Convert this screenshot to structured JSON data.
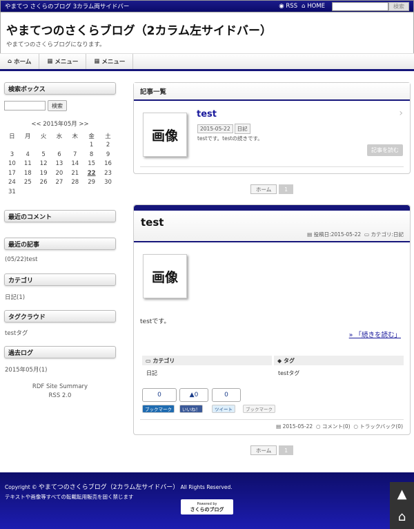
{
  "topbar": {
    "tagline": "やまてつ さくらのブログ 3カラム両サイドバー",
    "rss": "RSS",
    "home": "HOME",
    "search_button": "検索"
  },
  "header": {
    "title": "やまてつのさくらブログ（2カラム左サイドバー）",
    "subtitle": "やまてつのさくらブログになります。"
  },
  "nav": [
    {
      "label": "ホーム",
      "icon": "home-icon"
    },
    {
      "label": "メニュー",
      "icon": "grid-icon"
    },
    {
      "label": "メニュー",
      "icon": "grid-icon"
    }
  ],
  "sidebar": {
    "search": {
      "heading": "検索ボックス",
      "button": "検索"
    },
    "calendar": {
      "caption": "<< 2015年05月 >>",
      "weekdays": [
        "日",
        "月",
        "火",
        "水",
        "木",
        "金",
        "土"
      ],
      "rows": [
        [
          "",
          "",
          "",
          "",
          "",
          "1",
          "2"
        ],
        [
          "3",
          "4",
          "5",
          "6",
          "7",
          "8",
          "9"
        ],
        [
          "10",
          "11",
          "12",
          "13",
          "14",
          "15",
          "16"
        ],
        [
          "17",
          "18",
          "19",
          "20",
          "21",
          "22",
          "23"
        ],
        [
          "24",
          "25",
          "26",
          "27",
          "28",
          "29",
          "30"
        ],
        [
          "31",
          "",
          "",
          "",
          "",
          "",
          ""
        ]
      ],
      "today": "22"
    },
    "recent_comments": "最近のコメント",
    "recent_posts": {
      "heading": "最近の記事",
      "item": "(05/22)test"
    },
    "category": {
      "heading": "カテゴリ",
      "item": "日記(1)"
    },
    "tag_cloud": {
      "heading": "タグクラウド",
      "item": "testタグ"
    },
    "archive": {
      "heading": "過去ログ",
      "item": "2015年05月(1)"
    },
    "rdf": "RDF Site Summary",
    "rss": "RSS 2.0"
  },
  "list": {
    "heading": "記事一覧",
    "post": {
      "thumb": "画像",
      "title": "test",
      "date": "2015-05-22",
      "category": "日記",
      "excerpt": "testです。testの続きです。",
      "read_more": "記事を読む"
    },
    "pager": {
      "home": "ホーム",
      "page": "1"
    }
  },
  "article": {
    "title": "test",
    "posted": "投稿日:2015-05-22",
    "category_meta": "カテゴリ:日記",
    "thumb": "画像",
    "body": "testです。",
    "continue": "» 「続きを読む」",
    "cat_label": "カテゴリ",
    "cat_value": "日記",
    "tag_label": "タグ",
    "tag_value": "testタグ",
    "counts": [
      "0",
      "0",
      "0"
    ],
    "share": {
      "hatena": "ブックマーク",
      "like": "いいね！",
      "tweet": "ツイート",
      "bookmark2": "ブックマーク"
    },
    "foot": {
      "date": "2015-05-22",
      "comment": "コメント(0)",
      "trackback": "トラックバック(0)"
    },
    "pager": {
      "home": "ホーム",
      "page": "1"
    }
  },
  "footer": {
    "copyright_prefix": "Copyright ©",
    "site": "やまてつのさくらブログ（2カラム左サイドバー）",
    "rights": "All Rights Reserved.",
    "notice": "テキストや画像等すべての転載転用販売を固く禁じます",
    "badge_top": "Powered by",
    "badge": "さくらのブログ"
  },
  "colors": {
    "accent": "#15157a",
    "title_link": "#1a1a9c"
  }
}
